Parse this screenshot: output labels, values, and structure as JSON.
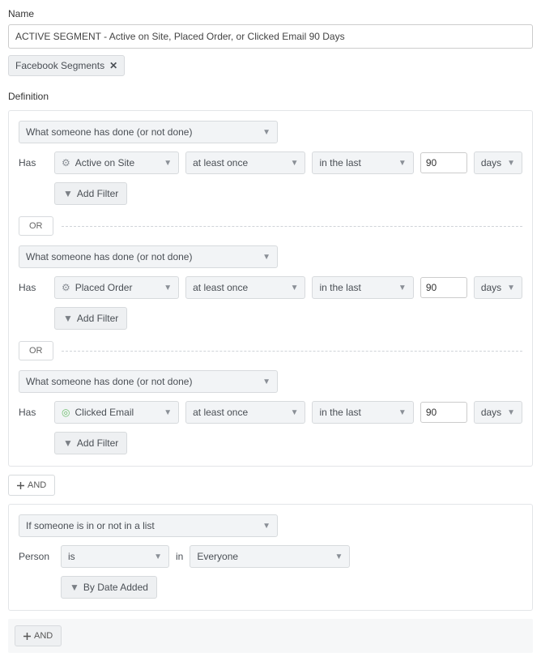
{
  "name_label": "Name",
  "name_value": "ACTIVE SEGMENT - Active on Site, Placed Order, or Clicked Email 90 Days",
  "tag_label": "Facebook Segments",
  "definition_label": "Definition",
  "condition_type": "What someone has done (or not done)",
  "has_label": "Has",
  "at_least_once": "at least once",
  "in_the_last": "in the last",
  "days_label": "days",
  "add_filter_label": "Add Filter",
  "or_label": "OR",
  "and_label": "AND",
  "metrics": {
    "active_on_site": "Active on Site",
    "placed_order": "Placed Order",
    "clicked_email": "Clicked Email"
  },
  "value_90": "90",
  "list_condition": "If someone is in or not in a list",
  "person_label": "Person",
  "is_label": "is",
  "in_label": "in",
  "everyone_label": "Everyone",
  "by_date_added": "By Date Added"
}
